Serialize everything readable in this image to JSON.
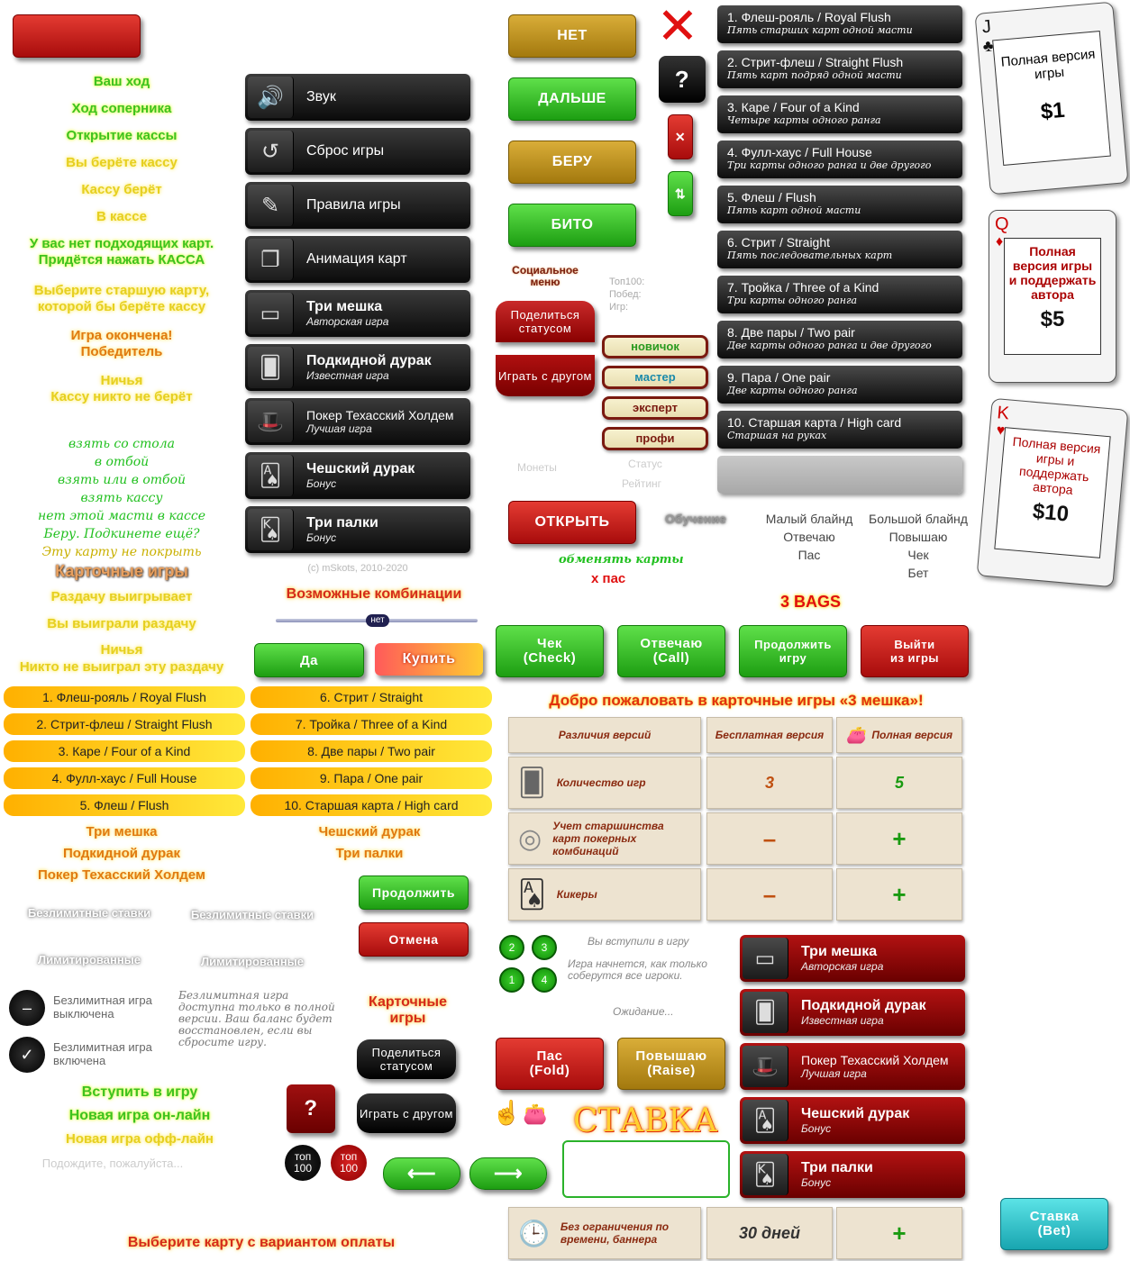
{
  "top": "топ",
  "status_messages": [
    "Ваш ход",
    "Ход соперника",
    "Открытие кассы",
    "Вы берёте кассу",
    "Кассу берёт",
    "В кассе",
    "У вас нет подходящих карт.",
    "Придётся нажать КАССА",
    "Выберите старшую карту,",
    "которой бы берёте кассу",
    "Игра окончена!",
    "Победитель",
    "Ничья",
    "Кассу никто не берёт"
  ],
  "phrases": [
    "взять со стола",
    "в отбой",
    "взять или в отбой",
    "взять кассу",
    "нет этой масти в кассе",
    "Беру. Подкинете ещё?",
    "Эту карту не покрыть"
  ],
  "card_games_title": "Карточные игры",
  "win_messages": [
    "Раздачу выигрывает",
    "Вы выиграли раздачу",
    "Ничья",
    "Никто не выиграл эту раздачу"
  ],
  "menu": [
    {
      "icon": "speaker-icon",
      "title": "Звук",
      "sub": ""
    },
    {
      "icon": "reset-icon",
      "title": "Сброс игры",
      "sub": ""
    },
    {
      "icon": "rules-icon",
      "title": "Правила игры",
      "sub": ""
    },
    {
      "icon": "cards-animation-icon",
      "title": "Анимация карт",
      "sub": ""
    },
    {
      "icon": "three-bags-icon",
      "title": "Три мешка",
      "sub": "Авторская игра"
    },
    {
      "icon": "podkidnoy-icon",
      "title": "Подкидной дурак",
      "sub": "Известная игра"
    },
    {
      "icon": "poker-hat-icon",
      "title": "Покер Техасский Холдем",
      "sub": "Лучшая игра"
    },
    {
      "icon": "czech-cards-icon",
      "title": "Чешский дурак",
      "sub": "Бонус"
    },
    {
      "icon": "three-sticks-icon",
      "title": "Три палки",
      "sub": "Бонус"
    }
  ],
  "copyright": "(c) mSkots, 2010-2020",
  "possible_combos": "Возможные комбинации",
  "slider_label": "нет",
  "yes_button": "Да",
  "buy_button": "Купить",
  "action_buttons": {
    "no": "НЕТ",
    "next": "ДАЛЬШЕ",
    "take": "БЕРУ",
    "bito": "БИТО",
    "open": "ОТКРЫТЬ"
  },
  "social": {
    "title": "Социальное меню",
    "share": "Поделиться статусом",
    "play_friend": "Играть с другом",
    "top100": "Топ100:",
    "wins": "Побед:",
    "games": "Игр:",
    "coins": "Монеты",
    "status": "Статус",
    "rating": "Рейтинг"
  },
  "levels": [
    "новичок",
    "мастер",
    "эксперт",
    "профи"
  ],
  "exchange": "обменять карты",
  "x_pass": "х пас",
  "training": "Обучение",
  "combinations": [
    {
      "t": "1. Флеш-рояль / Royal Flush",
      "d": "Пять старших карт одной масти"
    },
    {
      "t": "2. Стрит-флеш / Straight Flush",
      "d": "Пять карт подряд одной масти"
    },
    {
      "t": "3. Каре / Four of a Kind",
      "d": "Четыре карты одного ранга"
    },
    {
      "t": "4. Фулл-хаус / Full House",
      "d": "Три карты одного ранга и две другого"
    },
    {
      "t": "5. Флеш / Flush",
      "d": "Пять карт одной масти"
    },
    {
      "t": "6. Стрит / Straight",
      "d": "Пять последовательных карт"
    },
    {
      "t": "7. Тройка / Three of a Kind",
      "d": "Три карты одного ранга"
    },
    {
      "t": "8. Две пары / Two pair",
      "d": "Две карты одного ранга и две другого"
    },
    {
      "t": "9. Пара / One pair",
      "d": "Две карты одного ранга"
    },
    {
      "t": "10. Старшая карта / High card",
      "d": "Старшая на руках"
    }
  ],
  "blinds": {
    "small": "Малый блайнд",
    "big": "Большой блайнд",
    "call": "Отвечаю",
    "raise": "Повышаю",
    "pass": "Пас",
    "check": "Чек",
    "bet": "Бет"
  },
  "cards": [
    {
      "rank": "J",
      "suit": "♣",
      "text": "Полная версия игры",
      "price": "$1",
      "color": "#111"
    },
    {
      "rank": "Q",
      "suit": "♦",
      "text": "Полная версия игры и поддержать автора",
      "price": "$5",
      "color": "#c00"
    },
    {
      "rank": "K",
      "suit": "♥",
      "text": "Полная версия игры и поддержать автора",
      "price": "$10",
      "color": "#c00"
    }
  ],
  "bags_label": "3 BAGS",
  "poker_buttons": {
    "check": "Чек\n(Check)",
    "call": "Отвечаю\n(Call)",
    "continue": "Продолжить\nигру",
    "exit": "Выйти\nиз игры"
  },
  "welcome": "Добро пожаловать в карточные игры «3 мешка»!",
  "compare": {
    "header": [
      "Различия версий",
      "Бесплатная версия",
      "Полная версия"
    ],
    "rows": [
      {
        "icon": "cards-stack-icon",
        "label": "Количество игр",
        "free": "3",
        "full": "5"
      },
      {
        "icon": "chips-icon",
        "label": "Учет старшинства карт покерных комбинаций",
        "free": "–",
        "full": "+"
      },
      {
        "icon": "kicker-cards-icon",
        "label": "Кикеры",
        "free": "–",
        "full": "+"
      }
    ],
    "last": {
      "label": "Без ограничения по времени, баннера",
      "free": "30 дней",
      "full": "+"
    }
  },
  "pills_left": [
    "1. Флеш-рояль / Royal Flush",
    "2. Стрит-флеш / Straight Flush",
    "3. Каре / Four of a Kind",
    "4. Фулл-хаус / Full House",
    "5. Флеш / Flush"
  ],
  "pills_right": [
    "6. Стрит / Straight",
    "7. Тройка / Three of a Kind",
    "8. Две пары / Two pair",
    "9. Пара / One pair",
    "10. Старшая карта / High card"
  ],
  "game_names_left": [
    "Три мешка",
    "Подкидной дурак",
    "Покер Техасский Холдем"
  ],
  "game_names_right": [
    "Чешский дурак",
    "Три палки"
  ],
  "unlimited": "Безлимитные ставки",
  "limited": "Лимитированные",
  "continue_btn": "Продолжить",
  "cancel_btn": "Отмена",
  "unlim_off": "Безлимитная игра выключена",
  "unlim_on": "Безлимитная игра включена",
  "unlim_note": "Безлимитная игра доступна только в полной версии. Ваш баланс будет восстановлен, если вы сбросите игру.",
  "card_games_small": "Карточные игры",
  "join_game": "Вступить в игру",
  "new_online": "Новая игра он-лайн",
  "new_offline": "Новая игра офф-лайн",
  "wait": "Подождите, пожалуйста...",
  "online": {
    "seats": [
      "2",
      "3",
      "1",
      "4"
    ],
    "joined": "Вы вступили в игру",
    "starts": "Игра начнется, как только соберутся все игроки.",
    "waiting": "Ожидание..."
  },
  "fold": "Пас\n(Fold)",
  "raise": "Повышаю\n(Raise)",
  "stavka": "СТАВКА",
  "stavka_btn": "Ставка\n(Bet)",
  "hundred": "100",
  "question": "?",
  "choose_card": "Выберите карту с вариантом оплаты"
}
